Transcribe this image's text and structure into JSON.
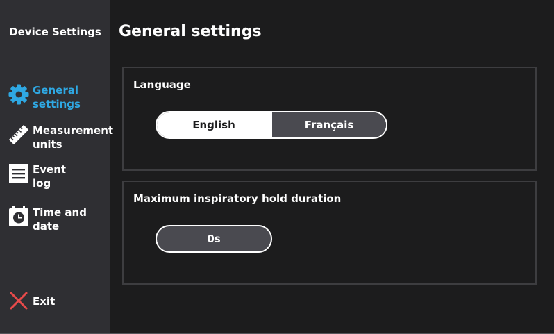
{
  "sidebar": {
    "title": "Device Settings",
    "items": [
      {
        "label": "General\nsettings",
        "icon": "gear-icon",
        "active": true
      },
      {
        "label": "Measurement\nunits",
        "icon": "ruler-icon",
        "active": false
      },
      {
        "label": "Event\nlog",
        "icon": "list-icon",
        "active": false
      },
      {
        "label": "Time and\ndate",
        "icon": "clock-icon",
        "active": false
      }
    ],
    "exit_label": "Exit"
  },
  "main": {
    "title": "General settings",
    "language": {
      "label": "Language",
      "options": [
        "English",
        "Français"
      ],
      "selected": "English"
    },
    "hold": {
      "label": "Maximum inspiratory hold duration",
      "value": "0s"
    }
  },
  "colors": {
    "accent": "#2fa8e3",
    "exit": "#e84a4a",
    "sidebar_bg": "#2f2f33",
    "main_bg": "#1c1c1d"
  }
}
